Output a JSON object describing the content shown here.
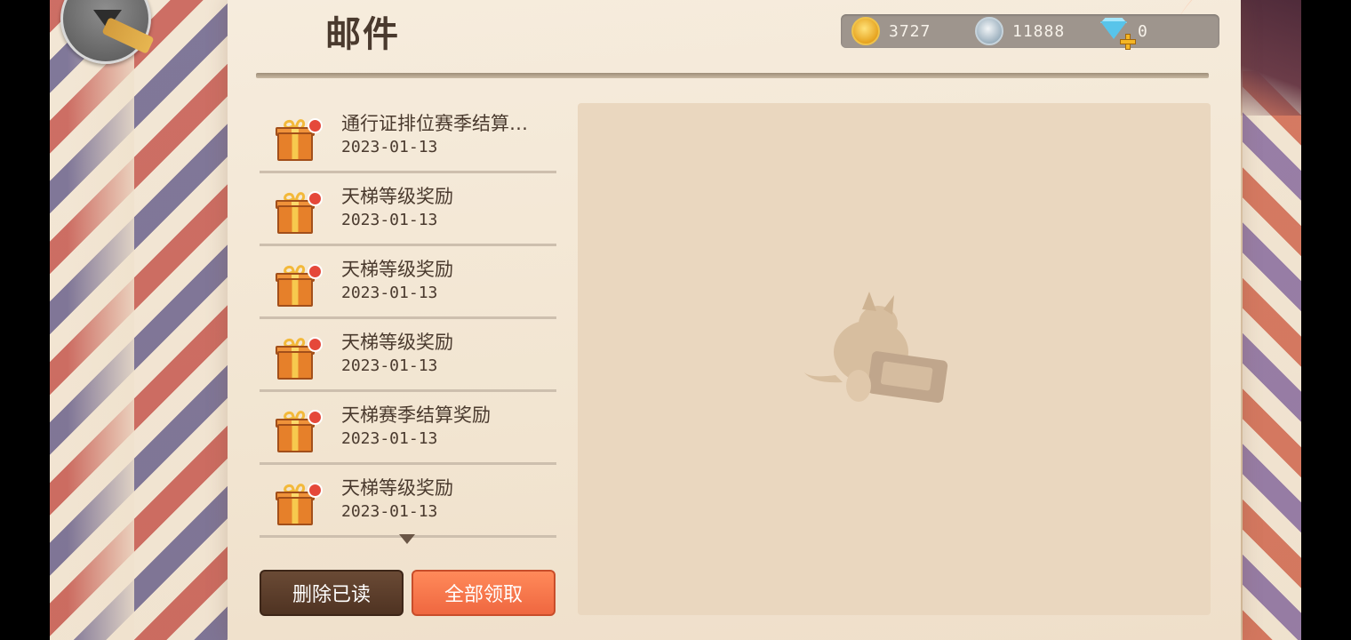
{
  "header": {
    "title": "邮件"
  },
  "currency": {
    "gold": "3727",
    "silver": "11888",
    "diamond": "0"
  },
  "mail_list": [
    {
      "title": "通行证排位赛季结算…",
      "date": "2023-01-13"
    },
    {
      "title": "天梯等级奖励",
      "date": "2023-01-13"
    },
    {
      "title": "天梯等级奖励",
      "date": "2023-01-13"
    },
    {
      "title": "天梯等级奖励",
      "date": "2023-01-13"
    },
    {
      "title": "天梯赛季结算奖励",
      "date": "2023-01-13"
    },
    {
      "title": "天梯等级奖励",
      "date": "2023-01-13"
    }
  ],
  "actions": {
    "delete_read": "删除已读",
    "claim_all": "全部领取"
  },
  "icons": {
    "back": "back-arrow-icon",
    "gold": "gold-coin-icon",
    "silver": "silver-coin-icon",
    "diamond": "diamond-plus-icon",
    "mail": "gift-icon",
    "unread": "red-dot-icon",
    "scroll": "chevron-down-icon"
  },
  "colors": {
    "claim_button": "#ef6740",
    "delete_button": "#4f3322",
    "unread_dot": "#e5483a"
  }
}
